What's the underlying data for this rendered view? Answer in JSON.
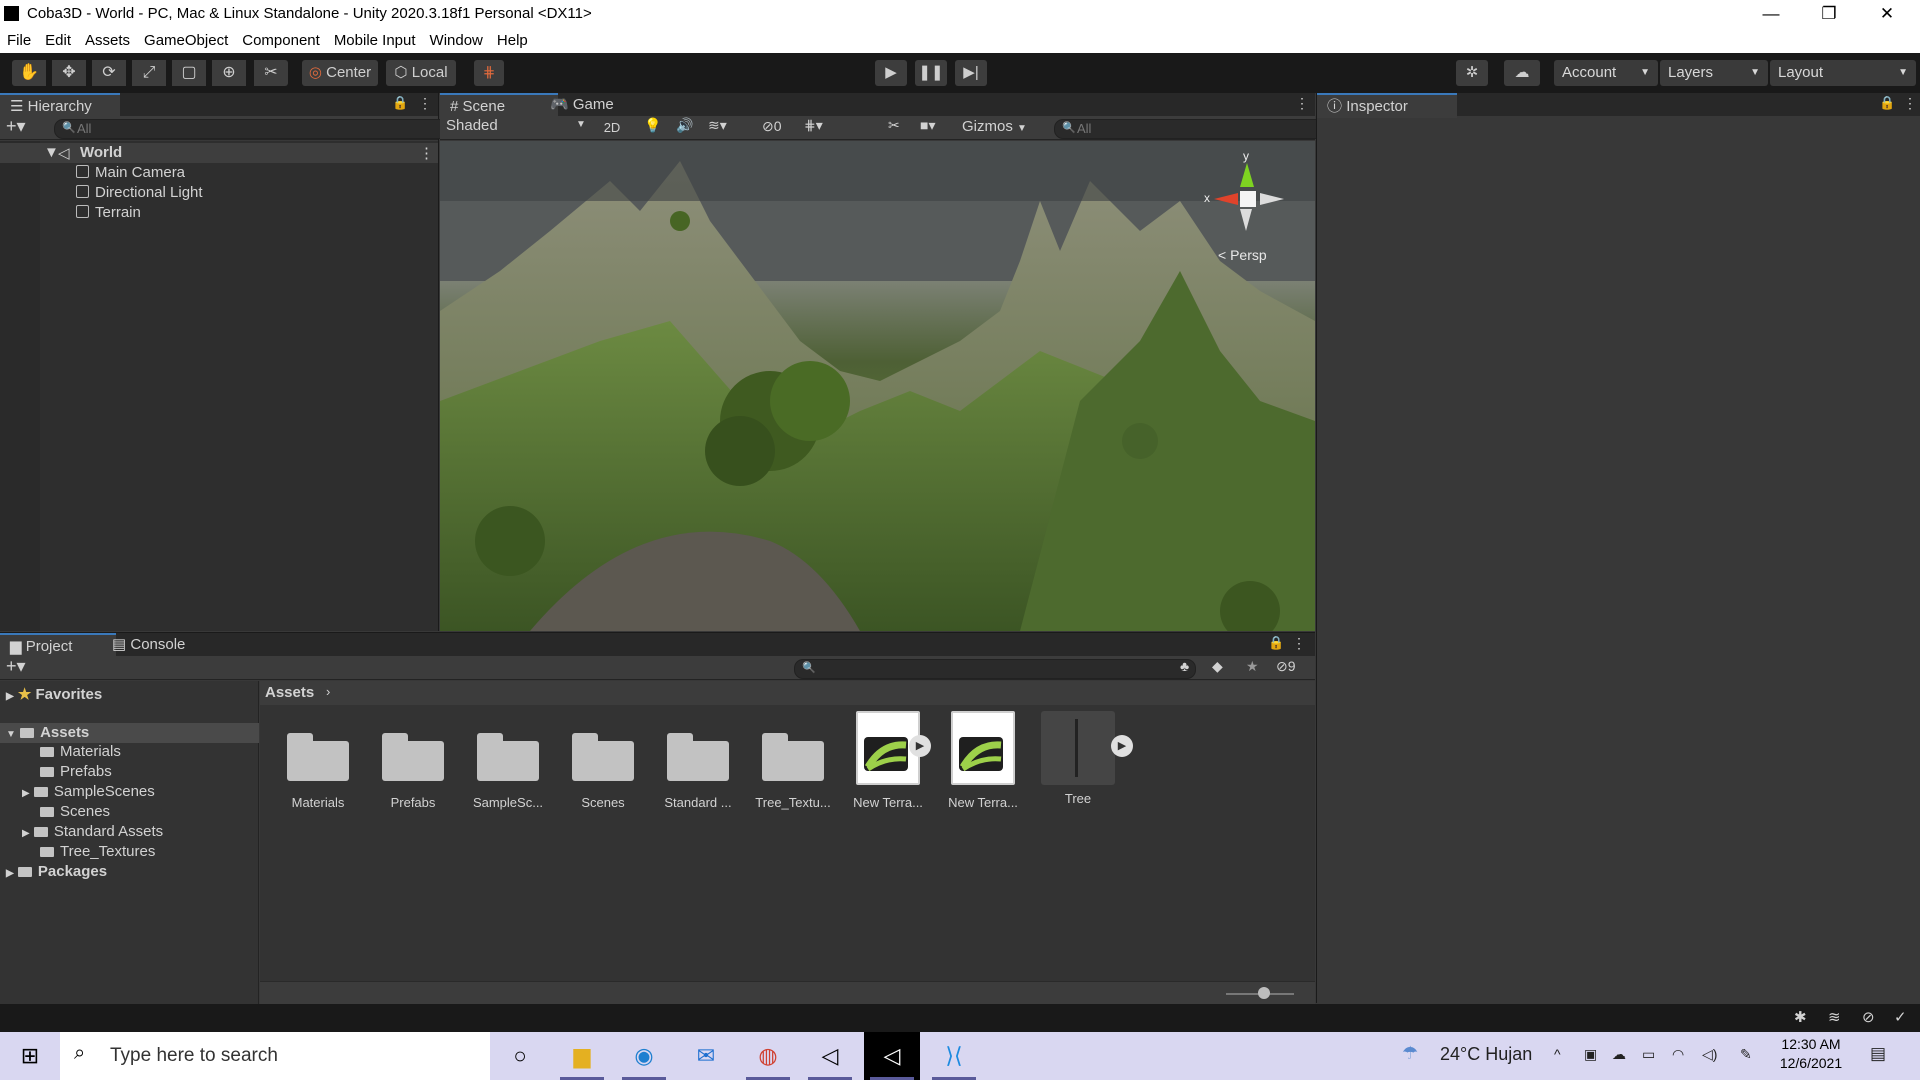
{
  "window": {
    "title": "Coba3D - World - PC, Mac & Linux Standalone - Unity 2020.3.18f1 Personal <DX11>",
    "controls": [
      "—",
      "❐",
      "✕"
    ]
  },
  "menu": [
    "File",
    "Edit",
    "Assets",
    "GameObject",
    "Component",
    "Mobile Input",
    "Window",
    "Help"
  ],
  "toolbar": {
    "tools": [
      "hand-tool-icon",
      "move-tool-icon",
      "rotate-tool-icon",
      "scale-tool-icon",
      "rect-tool-icon",
      "transform-tool-icon",
      "custom-tool-icon"
    ],
    "pivot_mode": "Center",
    "pivot_rotation": "Local",
    "account_label": "Account",
    "layers_label": "Layers",
    "layout_label": "Layout"
  },
  "hierarchy": {
    "tab": "Hierarchy",
    "search_placeholder": "All",
    "scene": "World",
    "objects": [
      "Main Camera",
      "Directional Light",
      "Terrain"
    ]
  },
  "scene_view": {
    "tabs": [
      "Scene",
      "Game"
    ],
    "draw_mode": "Shaded",
    "mode_2d": "2D",
    "hidden_count": "0",
    "gizmos_label": "Gizmos",
    "search_placeholder": "All",
    "gizmo_axes": {
      "y": "y",
      "x": "x"
    },
    "persp_label": "< Persp"
  },
  "inspector": {
    "tab": "Inspector"
  },
  "project": {
    "tabs": [
      "Project",
      "Console"
    ],
    "hidden_count": "9",
    "favorites": "Favorites",
    "assets_root": "Assets",
    "asset_folders": [
      "Materials",
      "Prefabs",
      "SampleScenes",
      "Scenes",
      "Standard Assets",
      "Tree_Textures"
    ],
    "packages": "Packages",
    "breadcrumb": "Assets",
    "grid_items": [
      {
        "name": "Materials",
        "kind": "folder"
      },
      {
        "name": "Prefabs",
        "kind": "folder"
      },
      {
        "name": "SampleSc...",
        "kind": "folder"
      },
      {
        "name": "Scenes",
        "kind": "folder"
      },
      {
        "name": "Standard ...",
        "kind": "folder"
      },
      {
        "name": "Tree_Textu...",
        "kind": "folder"
      },
      {
        "name": "New Terra...",
        "kind": "terrain"
      },
      {
        "name": "New Terra...",
        "kind": "terrain"
      },
      {
        "name": "Tree",
        "kind": "tree"
      }
    ]
  },
  "taskbar": {
    "search_placeholder": "Type here to search",
    "weather": "24°C  Hujan",
    "time": "12:30 AM",
    "date": "12/6/2021"
  },
  "colors": {
    "accent": "#3a79bb",
    "toolbar_bg": "#191919",
    "panel_bg": "#383838",
    "taskbar_bg": "#d9d7f1"
  }
}
